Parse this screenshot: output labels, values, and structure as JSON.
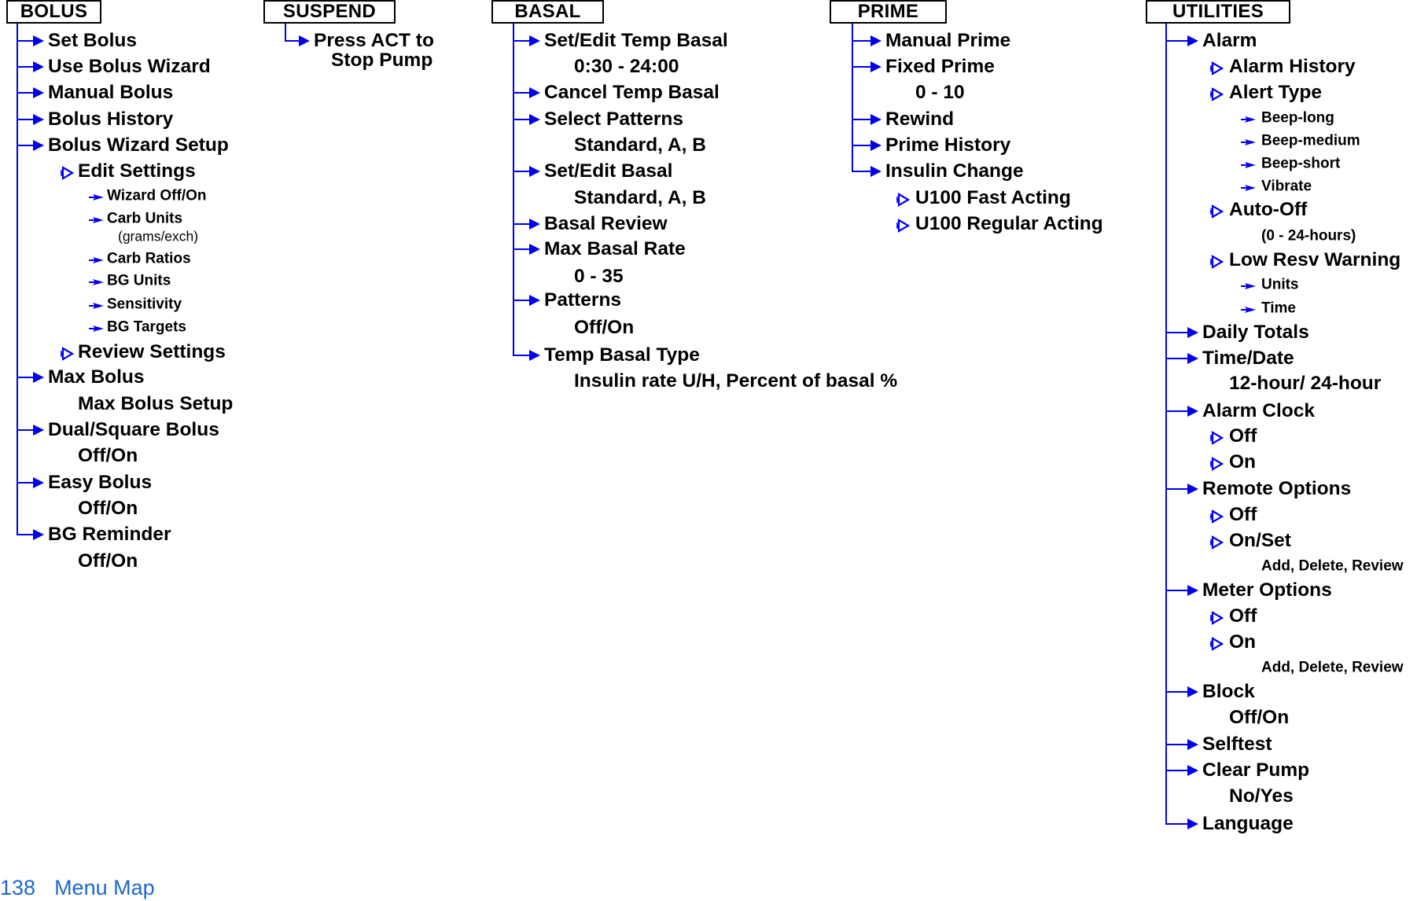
{
  "page": {
    "number": "138",
    "title": "Menu Map"
  },
  "colors": {
    "connector": "#0000ee",
    "text": "#000000",
    "footer": "#1c68cc"
  },
  "icons": {
    "branch": "filled-arrow-icon",
    "option": "outline-triangle-icon",
    "sub_option": "small-arrow-icon"
  },
  "columns": [
    {
      "title": "BOLUS",
      "items": [
        {
          "label": "Set Bolus",
          "kind": "menu"
        },
        {
          "label": "Use Bolus Wizard",
          "kind": "menu"
        },
        {
          "label": "Manual Bolus",
          "kind": "menu"
        },
        {
          "label": "Bolus History",
          "kind": "menu"
        },
        {
          "label": "Bolus Wizard Setup",
          "kind": "menu"
        },
        {
          "label": "Edit Settings",
          "kind": "option"
        },
        {
          "label": "Wizard Off/On",
          "kind": "sub-option"
        },
        {
          "label": "Carb Units",
          "kind": "sub-option"
        },
        {
          "label": "(grams/exch)",
          "kind": "note"
        },
        {
          "label": "Carb Ratios",
          "kind": "sub-option"
        },
        {
          "label": "BG Units",
          "kind": "sub-option"
        },
        {
          "label": "Sensitivity",
          "kind": "sub-option"
        },
        {
          "label": "BG Targets",
          "kind": "sub-option"
        },
        {
          "label": "Review Settings",
          "kind": "option"
        },
        {
          "label": "Max Bolus",
          "kind": "menu"
        },
        {
          "label": "Max Bolus Setup",
          "kind": "value"
        },
        {
          "label": "Dual/Square Bolus",
          "kind": "menu"
        },
        {
          "label": "Off/On",
          "kind": "value"
        },
        {
          "label": "Easy Bolus",
          "kind": "menu"
        },
        {
          "label": "Off/On",
          "kind": "value"
        },
        {
          "label": "BG Reminder",
          "kind": "menu"
        },
        {
          "label": "Off/On",
          "kind": "value"
        }
      ]
    },
    {
      "title": "SUSPEND",
      "items": [
        {
          "label": "Press ACT to",
          "kind": "menu"
        },
        {
          "label": "Stop Pump",
          "kind": "continuation"
        }
      ]
    },
    {
      "title": "BASAL",
      "items": [
        {
          "label": "Set/Edit Temp Basal",
          "kind": "menu"
        },
        {
          "label": "0:30 - 24:00",
          "kind": "value"
        },
        {
          "label": "Cancel Temp Basal",
          "kind": "menu"
        },
        {
          "label": "Select Patterns",
          "kind": "menu"
        },
        {
          "label": "Standard, A, B",
          "kind": "value"
        },
        {
          "label": "Set/Edit Basal",
          "kind": "menu"
        },
        {
          "label": "Standard, A, B",
          "kind": "value"
        },
        {
          "label": "Basal Review",
          "kind": "menu"
        },
        {
          "label": "Max Basal Rate",
          "kind": "menu"
        },
        {
          "label": "0 - 35",
          "kind": "value"
        },
        {
          "label": "Patterns",
          "kind": "menu"
        },
        {
          "label": "Off/On",
          "kind": "value"
        },
        {
          "label": "Temp Basal Type",
          "kind": "menu"
        },
        {
          "label": "Insulin rate U/H, Percent of basal %",
          "kind": "value"
        }
      ]
    },
    {
      "title": "PRIME",
      "items": [
        {
          "label": "Manual Prime",
          "kind": "menu"
        },
        {
          "label": "Fixed Prime",
          "kind": "menu"
        },
        {
          "label": "0 - 10",
          "kind": "value"
        },
        {
          "label": "Rewind",
          "kind": "menu"
        },
        {
          "label": "Prime History",
          "kind": "menu"
        },
        {
          "label": "Insulin Change",
          "kind": "menu"
        },
        {
          "label": "U100 Fast Acting",
          "kind": "option"
        },
        {
          "label": "U100 Regular Acting",
          "kind": "option"
        }
      ]
    },
    {
      "title": "UTILITIES",
      "items": [
        {
          "label": "Alarm",
          "kind": "menu"
        },
        {
          "label": "Alarm History",
          "kind": "option"
        },
        {
          "label": "Alert Type",
          "kind": "option"
        },
        {
          "label": "Beep-long",
          "kind": "sub-option"
        },
        {
          "label": "Beep-medium",
          "kind": "sub-option"
        },
        {
          "label": "Beep-short",
          "kind": "sub-option"
        },
        {
          "label": "Vibrate",
          "kind": "sub-option"
        },
        {
          "label": "Auto-Off",
          "kind": "option"
        },
        {
          "label": "(0 - 24-hours)",
          "kind": "sub-value"
        },
        {
          "label": "Low Resv Warning",
          "kind": "option"
        },
        {
          "label": "Units",
          "kind": "sub-option"
        },
        {
          "label": "Time",
          "kind": "sub-option"
        },
        {
          "label": "Daily Totals",
          "kind": "menu"
        },
        {
          "label": "Time/Date",
          "kind": "menu"
        },
        {
          "label": "12-hour/ 24-hour",
          "kind": "value"
        },
        {
          "label": "Alarm Clock",
          "kind": "menu"
        },
        {
          "label": "Off",
          "kind": "option"
        },
        {
          "label": "On",
          "kind": "option"
        },
        {
          "label": "Remote Options",
          "kind": "menu"
        },
        {
          "label": "Off",
          "kind": "option"
        },
        {
          "label": "On/Set",
          "kind": "option"
        },
        {
          "label": "Add, Delete, Review",
          "kind": "sub-value"
        },
        {
          "label": "Meter Options",
          "kind": "menu"
        },
        {
          "label": "Off",
          "kind": "option"
        },
        {
          "label": "On",
          "kind": "option"
        },
        {
          "label": "Add, Delete, Review",
          "kind": "sub-value"
        },
        {
          "label": "Block",
          "kind": "menu"
        },
        {
          "label": "Off/On",
          "kind": "value"
        },
        {
          "label": "Selftest",
          "kind": "menu"
        },
        {
          "label": "Clear Pump",
          "kind": "menu"
        },
        {
          "label": "No/Yes",
          "kind": "value"
        },
        {
          "label": "Language",
          "kind": "menu"
        }
      ]
    }
  ]
}
